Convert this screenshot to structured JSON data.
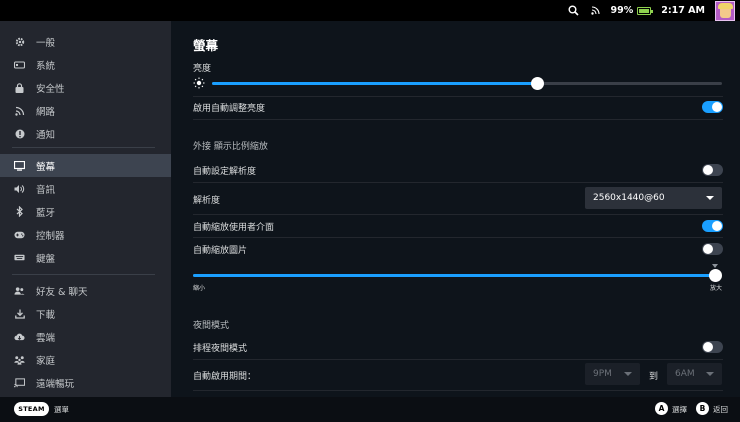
{
  "statusbar": {
    "battery_percent": "99%",
    "time": "2:17 AM",
    "icons": [
      "search-icon",
      "rss-icon",
      "battery-icon",
      "avatar"
    ]
  },
  "sidebar": {
    "items": [
      {
        "label": "一般",
        "icon": "gear-icon"
      },
      {
        "label": "系統",
        "icon": "system-icon"
      },
      {
        "label": "安全性",
        "icon": "lock-icon"
      },
      {
        "label": "網路",
        "icon": "wifi-icon"
      },
      {
        "label": "通知",
        "icon": "alert-icon"
      },
      {
        "label": "螢幕",
        "icon": "monitor-icon",
        "active": true
      },
      {
        "label": "音訊",
        "icon": "speaker-icon"
      },
      {
        "label": "藍牙",
        "icon": "bluetooth-icon"
      },
      {
        "label": "控制器",
        "icon": "gamepad-icon"
      },
      {
        "label": "鍵盤",
        "icon": "keyboard-icon"
      },
      {
        "label": "好友 & 聊天",
        "icon": "friends-icon"
      },
      {
        "label": "下載",
        "icon": "download-icon"
      },
      {
        "label": "雲端",
        "icon": "cloud-icon"
      },
      {
        "label": "家庭",
        "icon": "family-icon"
      },
      {
        "label": "遠端暢玩",
        "icon": "remote-play-icon"
      }
    ]
  },
  "main": {
    "title": "螢幕",
    "brightness": {
      "label": "亮度",
      "value_fraction": 0.64
    },
    "auto_brightness": {
      "label": "啟用自動調整亮度",
      "on": true
    },
    "external_group": "外接 顯示比例縮放",
    "auto_resolution": {
      "label": "自動設定解析度",
      "on": false
    },
    "resolution": {
      "label": "解析度",
      "value": "2560x1440@60"
    },
    "auto_scale_ui": {
      "label": "自動縮放使用者介面",
      "on": true
    },
    "auto_scale_images": {
      "label": "自動縮放圖片",
      "on": false
    },
    "scale_slider": {
      "min_label": "縮小",
      "max_label": "放大",
      "value_fraction": 1.0
    },
    "night_group": "夜間模式",
    "schedule_night": {
      "label": "排程夜間模式",
      "on": false
    },
    "auto_period": {
      "label": "自動啟用期間：",
      "from": "9PM",
      "to_label": "到",
      "to": "6AM"
    }
  },
  "bottombar": {
    "steam_label": "STEAM",
    "menu_label": "選單",
    "a_key": "A",
    "a_label": "選擇",
    "b_key": "B",
    "b_label": "返回"
  },
  "colors": {
    "accent": "#1a9fff",
    "sidebar_bg": "#23262e",
    "main_bg": "#0e141b",
    "active_item": "#3d4450"
  }
}
